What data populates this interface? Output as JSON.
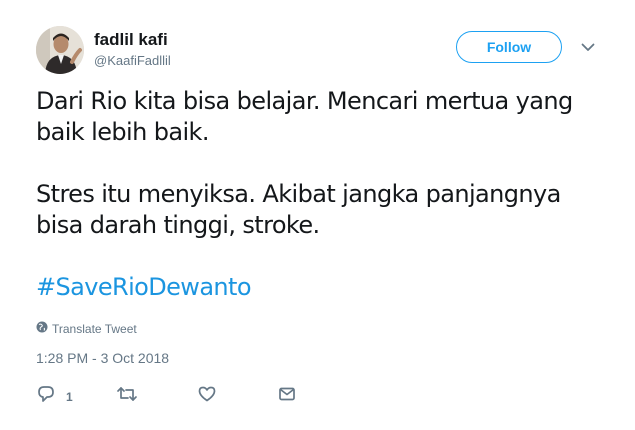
{
  "user": {
    "display_name": "fadlil kafi",
    "handle": "@KaafiFadllil",
    "avatar_icon": "user-photo"
  },
  "follow_button": {
    "label": "Follow",
    "accent_color": "#1da1f2"
  },
  "menu": {
    "icon": "chevron-down-icon"
  },
  "tweet": {
    "lines": [
      "Dari Rio kita bisa belajar. Mencari mertua yang baik lebih baik.",
      "Stres itu menyiksa. Akibat jangka panjangnya bisa darah tinggi, stroke."
    ],
    "hashtag": "#SaveRioDewanto",
    "hashtag_color": "#1b95e0"
  },
  "translate": {
    "icon": "globe-icon",
    "label": "Translate Tweet"
  },
  "timestamp": "1:28 PM - 3 Oct 2018",
  "actions": {
    "reply": {
      "icon": "reply-icon",
      "count": "1"
    },
    "retweet": {
      "icon": "retweet-icon"
    },
    "like": {
      "icon": "heart-icon"
    },
    "dm": {
      "icon": "envelope-icon"
    }
  }
}
